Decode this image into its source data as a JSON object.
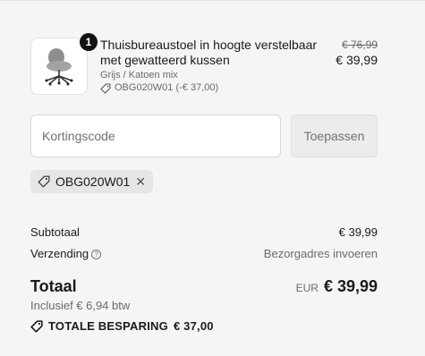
{
  "item": {
    "quantity": "1",
    "title": "Thuisbureaustoel in hoogte verstelbaar met gewatteerd kussen",
    "variant": "Grijs / Katoen mix",
    "discount": "OBG020W01 (-€ 37,00)",
    "compare_price": "€ 76,99",
    "price": "€ 39,99"
  },
  "discount_form": {
    "placeholder": "Kortingscode",
    "apply_label": "Toepassen"
  },
  "applied_code": "OBG020W01",
  "summary": {
    "subtotal_label": "Subtotaal",
    "subtotal_value": "€ 39,99",
    "shipping_label": "Verzending",
    "shipping_value": "Bezorgadres invoeren",
    "total_label": "Totaal",
    "currency": "EUR",
    "total_value": "€ 39,99",
    "tax_note": "Inclusief € 6,94 btw",
    "savings_label": "TOTALE BESPARING",
    "savings_value": "€ 37,00"
  },
  "icons": [
    "chair-image",
    "tag-icon",
    "close-icon",
    "help-icon"
  ]
}
